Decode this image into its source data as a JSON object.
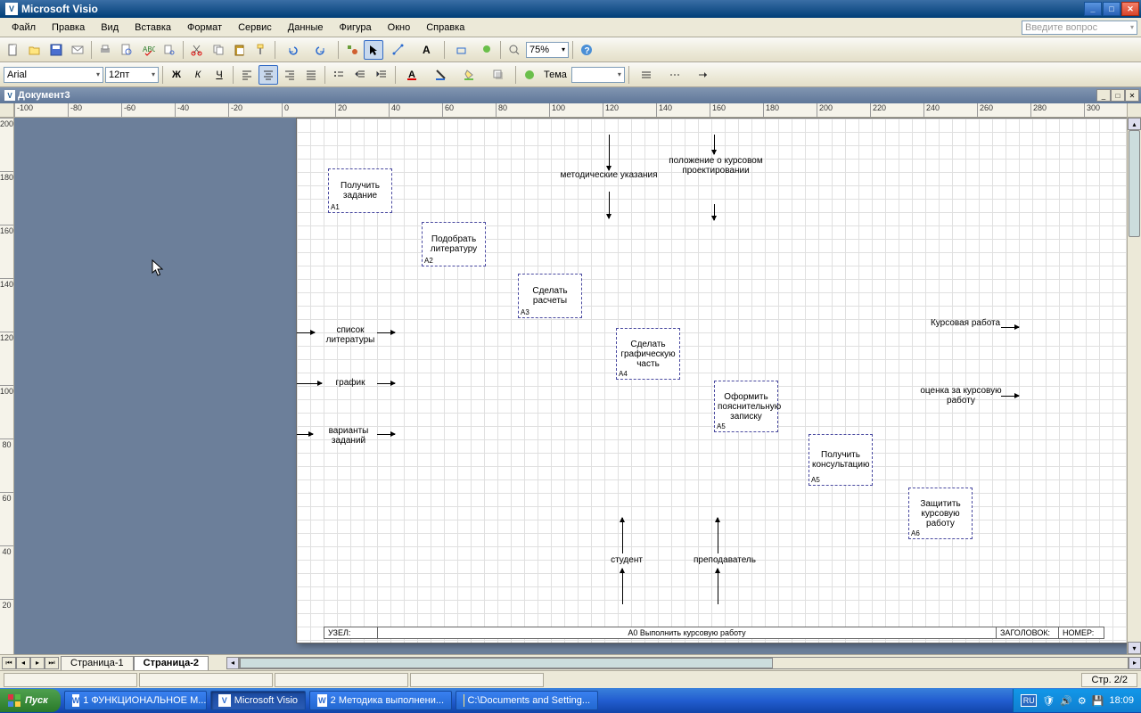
{
  "app": {
    "title": "Microsoft Visio",
    "ask": "Введите вопрос"
  },
  "menu": [
    "Файл",
    "Правка",
    "Вид",
    "Вставка",
    "Формат",
    "Сервис",
    "Данные",
    "Фигура",
    "Окно",
    "Справка"
  ],
  "zoom": "75%",
  "font": {
    "name": "Arial",
    "size": "12пт"
  },
  "theme_label": "Тема",
  "doc": {
    "title": "Документ3"
  },
  "ruler_h": [
    "-100",
    "-80",
    "-60",
    "-40",
    "-20",
    "0",
    "20",
    "40",
    "60",
    "80",
    "100",
    "120",
    "140",
    "160",
    "180",
    "200",
    "220",
    "240",
    "260",
    "280",
    "300"
  ],
  "ruler_v": [
    "200",
    "180",
    "160",
    "140",
    "120",
    "100",
    "80",
    "60",
    "40",
    "20"
  ],
  "diagram": {
    "blocks": {
      "a1": {
        "t": "Получить задание",
        "id": "А1"
      },
      "a2": {
        "t": "Подобрать литературу",
        "id": "А2"
      },
      "a3": {
        "t": "Сделать расчеты",
        "id": "А3"
      },
      "a4": {
        "t": "Сделать графическую часть",
        "id": "А4"
      },
      "a5": {
        "t": "Оформить пояснительную записку",
        "id": "А5"
      },
      "a5b": {
        "t": "Получить консультацию",
        "id": "А5"
      },
      "a6": {
        "t": "Защитить курсовую работу",
        "id": "А6"
      }
    },
    "labels": {
      "method": "методические указания",
      "position": "положение о курсовом проектировании",
      "list": "список литературы",
      "graph": "график",
      "variants": "варианты заданий",
      "kursovaya": "Курсовая работа",
      "ocenka": "оценка за курсовую работу",
      "student": "студент",
      "prepod": "преподаватель"
    }
  },
  "footer": {
    "uzel": "УЗЕЛ:",
    "a0": "А0 Выполнить курсовую работу",
    "zag": "ЗАГОЛОВОК:",
    "nomer": "НОМЕР:"
  },
  "tabs": [
    "Страница-1",
    "Страница-2"
  ],
  "status_page": "Стр. 2/2",
  "taskbar": {
    "start": "Пуск",
    "items": [
      "1 ФУНКЦИОНАЛЬНОЕ М...",
      "Microsoft Visio",
      "2 Методика выполнени...",
      "C:\\Documents and Setting..."
    ],
    "lang": "RU",
    "time": "18:09"
  }
}
